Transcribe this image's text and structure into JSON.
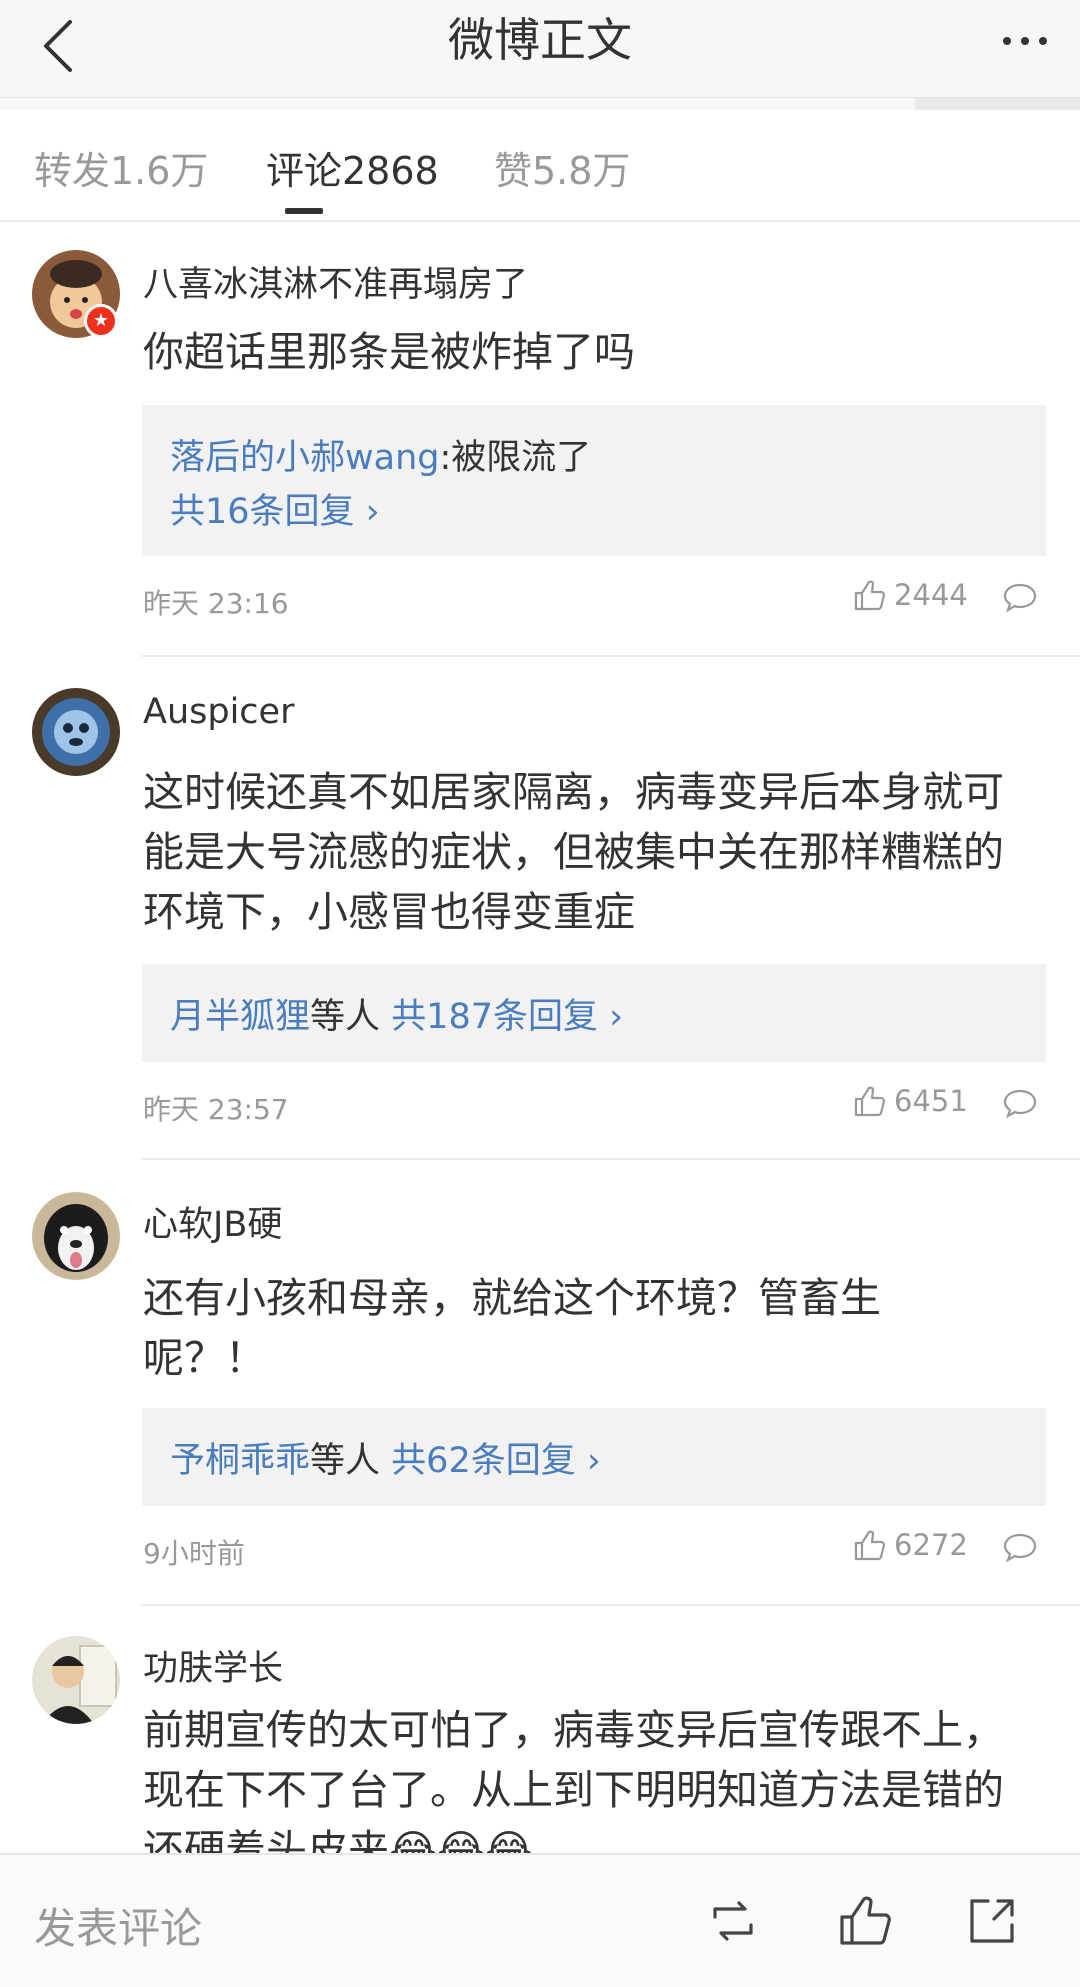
{
  "header": {
    "title": "微博正文"
  },
  "tabs": [
    {
      "label": "转发1.6万"
    },
    {
      "label": "评论2868"
    },
    {
      "label": "赞5.8万"
    }
  ],
  "comments": [
    {
      "username": "八喜冰淇淋不准再塌房了",
      "content": "你超话里那条是被炸掉了吗",
      "reply": {
        "author": "落后的小郝wang",
        "text": ":被限流了",
        "more": "共16条回复"
      },
      "time": "昨天 23:16",
      "likes": "2444"
    },
    {
      "username": "Auspicer",
      "content": "这时候还真不如居家隔离，病毒变异后本身就可能是大号流感的症状，但被集中关在那样糟糕的环境下，小感冒也得变重症",
      "reply": {
        "author": "月半狐狸",
        "suffix": "等人",
        "more": "共187条回复"
      },
      "time": "昨天 23:57",
      "likes": "6451"
    },
    {
      "username": "心软JB硬",
      "content": "还有小孩和母亲，就给这个环境？管畜生呢？！",
      "reply": {
        "author": "予桐乖乖",
        "suffix": "等人",
        "more": "共62条回复"
      },
      "time": "9小时前",
      "likes": "6272"
    },
    {
      "username": "功肤学长",
      "content": "前期宣传的太可怕了，病毒变异后宣传跟不上，现在下不了台了。从上到下明明知道方法是错的还硬着头皮来😂😂😂"
    }
  ],
  "bottom_bar": {
    "compose_placeholder": "发表评论"
  }
}
